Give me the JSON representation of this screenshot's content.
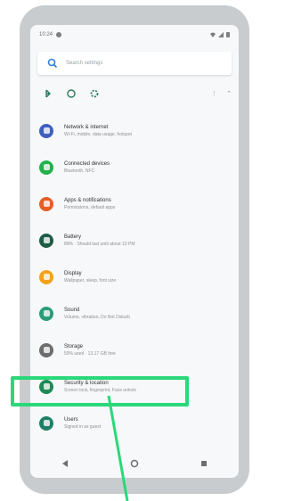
{
  "status_bar": {
    "time": "10:24"
  },
  "search": {
    "placeholder": "Search settings"
  },
  "colors": {
    "highlight": "#2ad87a",
    "network": "#3f5fbf",
    "connected": "#22b14c",
    "apps": "#e45f26",
    "battery": "#1f5c45",
    "display": "#f2a21a",
    "sound": "#2a9c79",
    "storage": "#6d6d6d",
    "security": "#1f8a57",
    "users": "#1f7f66"
  },
  "settings": [
    {
      "title": "Network & internet",
      "subtitle": "Wi-Fi, mobile, data usage, hotspot",
      "icon": "network-icon"
    },
    {
      "title": "Connected devices",
      "subtitle": "Bluetooth, NFC",
      "icon": "bluetooth-icon"
    },
    {
      "title": "Apps & notifications",
      "subtitle": "Permissions, default apps",
      "icon": "apps-icon"
    },
    {
      "title": "Battery",
      "subtitle": "89% · Should last until about 10 PM",
      "icon": "battery-icon"
    },
    {
      "title": "Display",
      "subtitle": "Wallpaper, sleep, font size",
      "icon": "display-icon"
    },
    {
      "title": "Sound",
      "subtitle": "Volume, vibration, Do Not Disturb",
      "icon": "sound-icon"
    },
    {
      "title": "Storage",
      "subtitle": "59% used · 13.17 GB free",
      "icon": "storage-icon"
    },
    {
      "title": "Security & location",
      "subtitle": "Screen lock, fingerprint, Face unlock",
      "icon": "shield-icon"
    },
    {
      "title": "Users",
      "subtitle": "Signed in as guest",
      "icon": "user-icon"
    }
  ]
}
